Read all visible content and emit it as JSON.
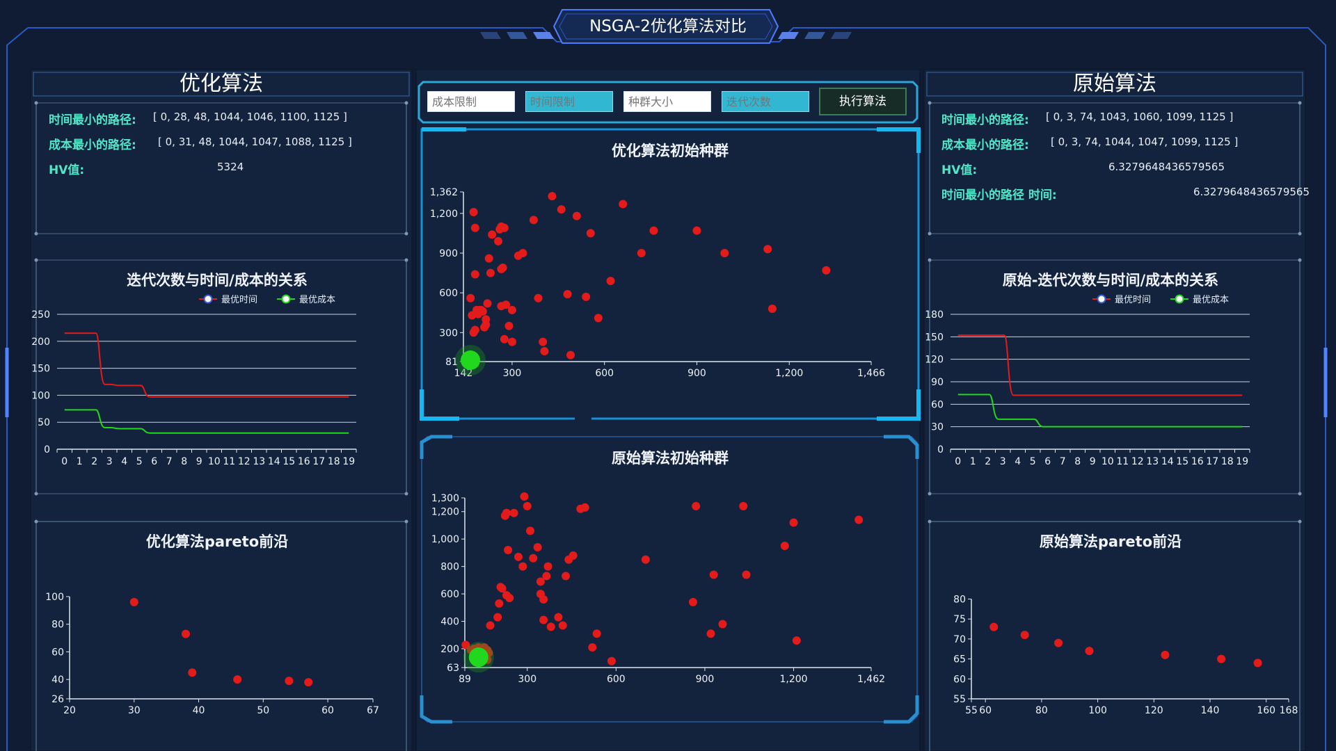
{
  "header": {
    "title": "NSGA-2优化算法对比"
  },
  "left": {
    "title": "优化算法",
    "info": [
      {
        "label": "时间最小的路径:",
        "value": "[ 0, 28, 48, 1044, 1046, 1100, 1125 ]"
      },
      {
        "label": "成本最小的路径:",
        "value": "[ 0, 31, 48, 1044, 1047, 1088, 1125 ]"
      },
      {
        "label": "HV值:",
        "value": "5324"
      }
    ]
  },
  "right": {
    "title": "原始算法",
    "info": [
      {
        "label": "时间最小的路径:",
        "value": "[ 0, 3, 74, 1043, 1060, 1099, 1125 ]"
      },
      {
        "label": "成本最小的路径:",
        "value": "[ 0, 3, 74, 1044, 1047, 1099, 1125 ]"
      },
      {
        "label": "HV值:",
        "value": "6.3279648436579565"
      },
      {
        "label": "时间最小的路径 时间:",
        "value": "6.3279648436579565"
      }
    ]
  },
  "controls": {
    "inputs": [
      {
        "placeholder": "成本限制"
      },
      {
        "placeholder": "时间限制"
      },
      {
        "placeholder": "种群大小"
      },
      {
        "placeholder": "迭代次数"
      }
    ],
    "run_label": "执行算法"
  },
  "colors": {
    "accent": "#1fa9e0",
    "red": "#e31b1b",
    "green": "#22d81e",
    "label": "#52e6c9"
  },
  "chart_data": [
    {
      "id": "left_iter",
      "type": "line",
      "title": "迭代次数与时间/成本的关系",
      "categories": [
        "0",
        "1",
        "2",
        "3",
        "4",
        "5",
        "6",
        "7",
        "8",
        "9",
        "10",
        "11",
        "12",
        "13",
        "14",
        "15",
        "16",
        "17",
        "18",
        "19"
      ],
      "yticks": [
        0,
        50,
        100,
        150,
        200,
        250
      ],
      "ylim": [
        0,
        250
      ],
      "series": [
        {
          "name": "最优时间",
          "color": "#e31b1b",
          "values": [
            215,
            215,
            215,
            120,
            118,
            118,
            97,
            97,
            97,
            97,
            97,
            97,
            97,
            97,
            97,
            97,
            97,
            97,
            97,
            97
          ]
        },
        {
          "name": "最优成本",
          "color": "#22d81e",
          "values": [
            73,
            73,
            73,
            40,
            38,
            38,
            30,
            30,
            30,
            30,
            30,
            30,
            30,
            30,
            30,
            30,
            30,
            30,
            30,
            30
          ]
        }
      ],
      "legend": "top-right",
      "grid": true
    },
    {
      "id": "right_iter",
      "type": "line",
      "title": "原始-迭代次数与时间/成本的关系",
      "categories": [
        "0",
        "1",
        "2",
        "3",
        "4",
        "5",
        "6",
        "7",
        "8",
        "9",
        "10",
        "11",
        "12",
        "13",
        "14",
        "15",
        "16",
        "17",
        "18",
        "19"
      ],
      "yticks": [
        0,
        30,
        60,
        90,
        120,
        150,
        180
      ],
      "ylim": [
        0,
        180
      ],
      "series": [
        {
          "name": "最优时间",
          "color": "#e31b1b",
          "values": [
            152,
            152,
            152,
            152,
            72,
            72,
            72,
            72,
            72,
            72,
            72,
            72,
            72,
            72,
            72,
            72,
            72,
            72,
            72,
            72
          ]
        },
        {
          "name": "最优成本",
          "color": "#22d81e",
          "values": [
            73,
            73,
            73,
            40,
            40,
            40,
            30,
            30,
            30,
            30,
            30,
            30,
            30,
            30,
            30,
            30,
            30,
            30,
            30,
            30
          ]
        }
      ],
      "legend": "top-right",
      "grid": true
    },
    {
      "id": "opt_initial",
      "type": "scatter",
      "title": "优化算法初始种群",
      "xticks": [
        142,
        300,
        600,
        900,
        1200,
        1466
      ],
      "xlim": [
        142,
        1466
      ],
      "yticks": [
        81,
        300,
        600,
        900,
        1200,
        1362
      ],
      "ylim": [
        81,
        1362
      ],
      "points": [
        [
          175,
          1210
        ],
        [
          180,
          1090
        ],
        [
          180,
          740
        ],
        [
          165,
          560
        ],
        [
          170,
          430
        ],
        [
          175,
          300
        ],
        [
          180,
          320
        ],
        [
          185,
          470
        ],
        [
          190,
          440
        ],
        [
          195,
          470
        ],
        [
          200,
          470
        ],
        [
          205,
          460
        ],
        [
          210,
          340
        ],
        [
          215,
          360
        ],
        [
          215,
          400
        ],
        [
          220,
          520
        ],
        [
          225,
          860
        ],
        [
          230,
          750
        ],
        [
          235,
          1040
        ],
        [
          255,
          990
        ],
        [
          260,
          1080
        ],
        [
          265,
          1100
        ],
        [
          275,
          1090
        ],
        [
          265,
          780
        ],
        [
          270,
          790
        ],
        [
          265,
          500
        ],
        [
          275,
          250
        ],
        [
          280,
          510
        ],
        [
          290,
          350
        ],
        [
          300,
          230
        ],
        [
          300,
          470
        ],
        [
          320,
          880
        ],
        [
          335,
          900
        ],
        [
          370,
          1150
        ],
        [
          385,
          560
        ],
        [
          400,
          230
        ],
        [
          405,
          160
        ],
        [
          430,
          1330
        ],
        [
          460,
          1230
        ],
        [
          480,
          590
        ],
        [
          490,
          130
        ],
        [
          510,
          1180
        ],
        [
          540,
          570
        ],
        [
          555,
          1050
        ],
        [
          580,
          410
        ],
        [
          620,
          690
        ],
        [
          660,
          1270
        ],
        [
          720,
          900
        ],
        [
          760,
          1070
        ],
        [
          900,
          1070
        ],
        [
          990,
          900
        ],
        [
          1130,
          930
        ],
        [
          1145,
          480
        ],
        [
          1320,
          770
        ]
      ],
      "highlight": [
        [
          142,
          81
        ]
      ]
    },
    {
      "id": "orig_initial",
      "type": "scatter",
      "title": "原始算法初始种群",
      "xticks": [
        89,
        300,
        600,
        900,
        1200,
        1462
      ],
      "xlim": [
        89,
        1462
      ],
      "yticks": [
        63,
        200,
        400,
        600,
        800,
        1000,
        1200,
        1300
      ],
      "ylim": [
        63,
        1300
      ],
      "points": [
        [
          92,
          228
        ],
        [
          110,
          190
        ],
        [
          120,
          200
        ],
        [
          135,
          210
        ],
        [
          155,
          210
        ],
        [
          165,
          120
        ],
        [
          165,
          190
        ],
        [
          170,
          170
        ],
        [
          175,
          370
        ],
        [
          200,
          430
        ],
        [
          205,
          530
        ],
        [
          215,
          640
        ],
        [
          225,
          1170
        ],
        [
          230,
          1190
        ],
        [
          210,
          650
        ],
        [
          230,
          590
        ],
        [
          235,
          920
        ],
        [
          240,
          570
        ],
        [
          255,
          1190
        ],
        [
          270,
          870
        ],
        [
          285,
          800
        ],
        [
          290,
          1310
        ],
        [
          300,
          1240
        ],
        [
          310,
          1060
        ],
        [
          320,
          860
        ],
        [
          335,
          940
        ],
        [
          345,
          690
        ],
        [
          345,
          600
        ],
        [
          355,
          410
        ],
        [
          355,
          560
        ],
        [
          365,
          730
        ],
        [
          370,
          800
        ],
        [
          380,
          360
        ],
        [
          405,
          430
        ],
        [
          420,
          370
        ],
        [
          430,
          730
        ],
        [
          440,
          850
        ],
        [
          455,
          880
        ],
        [
          480,
          1220
        ],
        [
          495,
          1230
        ],
        [
          520,
          210
        ],
        [
          535,
          310
        ],
        [
          585,
          110
        ],
        [
          700,
          850
        ],
        [
          860,
          540
        ],
        [
          870,
          1240
        ],
        [
          920,
          310
        ],
        [
          930,
          740
        ],
        [
          960,
          380
        ],
        [
          1030,
          1240
        ],
        [
          1040,
          740
        ],
        [
          1170,
          950
        ],
        [
          1200,
          1120
        ],
        [
          1210,
          260
        ],
        [
          1420,
          1140
        ]
      ],
      "highlight": [
        [
          112,
          128
        ]
      ]
    },
    {
      "id": "opt_pareto",
      "type": "scatter",
      "title": "优化算法pareto前沿",
      "xticks": [
        20,
        30,
        40,
        50,
        60,
        67
      ],
      "xlim": [
        20,
        67
      ],
      "yticks": [
        26,
        40,
        60,
        80,
        100
      ],
      "ylim": [
        26,
        104
      ],
      "points": [
        [
          30,
          96
        ],
        [
          38,
          73
        ],
        [
          39,
          45
        ],
        [
          46,
          40
        ],
        [
          54,
          39
        ],
        [
          57,
          38
        ]
      ]
    },
    {
      "id": "orig_pareto",
      "type": "scatter",
      "title": "原始算法pareto前沿",
      "xticks": [
        55,
        60,
        80,
        100,
        120,
        140,
        160,
        168
      ],
      "xlim": [
        55,
        168
      ],
      "yticks": [
        55,
        60,
        65,
        70,
        75,
        80
      ],
      "ylim": [
        55,
        82
      ],
      "points": [
        [
          63,
          73
        ],
        [
          74,
          71
        ],
        [
          86,
          69
        ],
        [
          97,
          67
        ],
        [
          124,
          66
        ],
        [
          144,
          65
        ],
        [
          157,
          64
        ]
      ]
    }
  ]
}
